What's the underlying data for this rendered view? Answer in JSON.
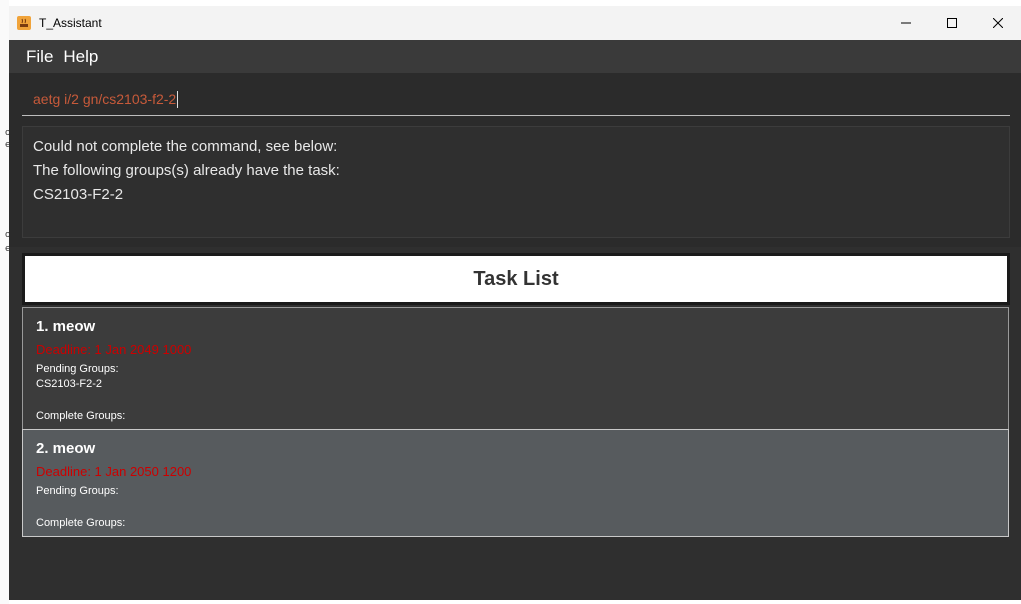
{
  "window": {
    "title": "T_Assistant"
  },
  "menu": {
    "items": [
      "File",
      "Help"
    ]
  },
  "command": {
    "value": "aetg i/2 gn/cs2103-f2-2"
  },
  "result": {
    "lines": [
      "Could not complete the command, see below:",
      "The following groups(s) already have the task:",
      "CS2103-F2-2"
    ]
  },
  "task_list": {
    "header": "Task List",
    "tasks": [
      {
        "title": "1. meow",
        "deadline": "Deadline: 1 Jan 2049 1000",
        "pending_label": "Pending Groups:",
        "pending_groups": "CS2103-F2-2",
        "complete_label": "Complete Groups:"
      },
      {
        "title": "2. meow",
        "deadline": "Deadline: 1 Jan 2050 1200",
        "pending_label": "Pending Groups:",
        "pending_groups": "",
        "complete_label": "Complete Groups:"
      }
    ]
  },
  "icons": {
    "app": "java-app-icon",
    "minimize": "minimize-icon",
    "maximize": "maximize-icon",
    "close": "close-icon"
  },
  "colors": {
    "command_text": "#c75a3a",
    "deadline": "#cc0000",
    "background": "#2b2b2b"
  }
}
